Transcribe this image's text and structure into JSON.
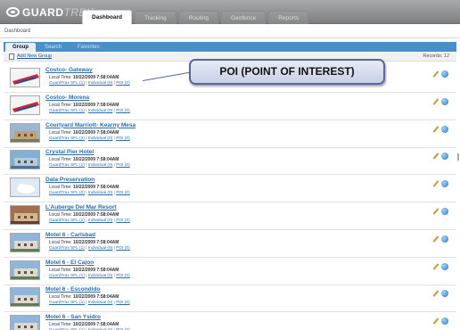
{
  "app": {
    "logo_main": "GUARD",
    "logo_light": "TREK"
  },
  "nav": {
    "tabs": [
      "Dashboard",
      "Tracking",
      "Routing",
      "Geofence",
      "Reports"
    ],
    "active": "Dashboard"
  },
  "breadcrumb": "Dashboard",
  "subtabs": [
    "Group",
    "Search",
    "Favorites"
  ],
  "toolbar": {
    "add_label": "Add New Group",
    "records_label": "Records: 12"
  },
  "callout": {
    "text": "POI (POINT OF INTEREST)",
    "color": "#5767a3"
  },
  "colors": {
    "accent": "#4a90c8",
    "link": "#2a6db5",
    "topbar": "#8f9092"
  },
  "rows": [
    {
      "title": "Costco- Gateway",
      "time_label": "Local Time:",
      "time": "10/22/2009 7:58:04AM",
      "links": [
        "GuardTrax SFL (1)",
        "Individual (0)",
        "POI (0)"
      ],
      "thumb": "costco-icon"
    },
    {
      "title": "Costco- Morena",
      "time_label": "Local Time:",
      "time": "10/22/2009 7:58:04AM",
      "links": [
        "GuardTrax SFL (1)",
        "Individual (0)",
        "POI (0)"
      ],
      "thumb": "costco-icon"
    },
    {
      "title": "Courtyard Marriott- Kearny Mesa",
      "time_label": "Local Time:",
      "time": "10/22/2009 7:58:04AM",
      "links": [
        "GuardTrax SFL (2)",
        "Individual (0)",
        "POI (0)"
      ],
      "thumb": "hotel-photo"
    },
    {
      "title": "Crystal Pier Hotel",
      "time_label": "Local Time:",
      "time": "10/22/2009 7:58:04AM",
      "links": [
        "GuardTrax SFL (1)",
        "Individual (0)",
        "POI (0)"
      ],
      "thumb": "pier-photo"
    },
    {
      "title": "Data Preservation",
      "time_label": "Local Time:",
      "time": "10/22/2009 7:58:04AM",
      "links": [
        "GuardTrax SFL (0)",
        "Individual (0)",
        "POI (0)"
      ],
      "thumb": "data-icon"
    },
    {
      "title": "L'Auberge Del Mar Resort",
      "time_label": "Local Time:",
      "time": "10/22/2009 7:58:04AM",
      "links": [
        "GuardTrax SFL (1)",
        "Individual (0)",
        "POI (0)"
      ],
      "thumb": "resort-photo"
    },
    {
      "title": "Motel 6 - Carlsbad",
      "time_label": "Local Time:",
      "time": "10/22/2009 7:58:04AM",
      "links": [
        "GuardTrax SFL (1)",
        "Individual (0)",
        "POI (0)"
      ],
      "thumb": "motel-photo"
    },
    {
      "title": "Motel 6 - El Cajon",
      "time_label": "Local Time:",
      "time": "10/22/2009 7:58:04AM",
      "links": [
        "GuardTrax SFL (1)",
        "Individual (0)",
        "POI (0)"
      ],
      "thumb": "motel-photo"
    },
    {
      "title": "Motel 6 - Escondido",
      "time_label": "Local Time:",
      "time": "10/22/2009 7:58:04AM",
      "links": [
        "GuardTrax SFL (1)",
        "Individual (0)",
        "POI (0)"
      ],
      "thumb": "motel-photo"
    },
    {
      "title": "Motel 6 - San Ysidro",
      "time_label": "Local Time:",
      "time": "10/22/2009 7:58:04AM",
      "links": [
        "GuardTrax SFL (1)",
        "Individual (0)",
        "POI (0)"
      ],
      "thumb": "motel-photo"
    }
  ]
}
